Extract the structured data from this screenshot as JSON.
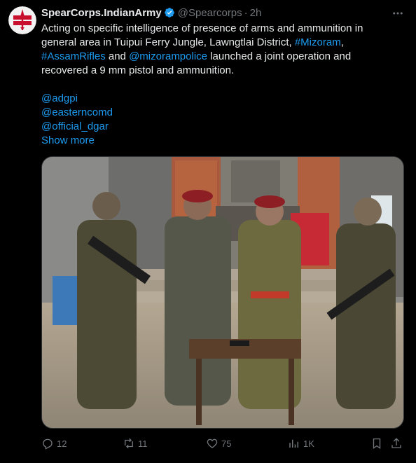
{
  "author": {
    "display_name": "SpearCorps.IndianArmy",
    "handle": "@Spearcorps",
    "separator": "·",
    "time": "2h",
    "avatar_icon": "spear-corps-emblem-icon",
    "verified_icon": "verified-badge-icon"
  },
  "tweet": {
    "line1": "Acting on specific intelligence of presence of arms and ammunition in",
    "line2_text": "general area in Tuipui Ferry Jungle, Lawngtlai District, ",
    "line2_link": "#Mizoram",
    "line2_tail": ",",
    "line3_link1": "#AssamRifles",
    "line3_mid": " and ",
    "line3_link2": "@mizorampolice",
    "line3_tail": " launched a joint operation and",
    "line4": "recovered a 9 mm pistol and ammunition.",
    "mentions": [
      "@adgpi",
      "@easterncomd",
      "@official_dgar"
    ],
    "show_more": "Show more"
  },
  "media": {
    "description_icon": "photo-of-security-personnel-with-recovered-pistol"
  },
  "actions": {
    "replies": "12",
    "reposts": "11",
    "likes": "75",
    "views": "1K",
    "icons": [
      "reply-icon",
      "repost-icon",
      "like-icon",
      "views-icon",
      "bookmark-icon",
      "share-icon"
    ]
  },
  "colors": {
    "background": "#000000",
    "text": "#e7e9ea",
    "muted": "#71767b",
    "link": "#1d9bf0",
    "verified": "#1d9bf0"
  }
}
